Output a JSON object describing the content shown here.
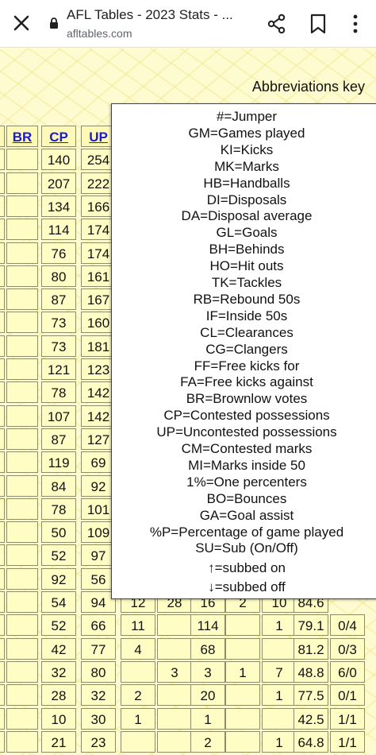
{
  "browser": {
    "title": "AFL Tables - 2023 Stats - ...",
    "url": "afltables.com"
  },
  "page": {
    "abbreviations_key": "Abbreviations key"
  },
  "table": {
    "headers": [
      "BR",
      "CP",
      "UP"
    ],
    "rows": [
      [
        "",
        "140",
        "254",
        "",
        "",
        "",
        "",
        "",
        ""
      ],
      [
        "",
        "207",
        "222",
        "",
        "",
        "",
        "",
        "",
        ""
      ],
      [
        "",
        "134",
        "166",
        "",
        "",
        "",
        "",
        "",
        ""
      ],
      [
        "",
        "114",
        "174",
        "",
        "",
        "",
        "",
        "",
        ""
      ],
      [
        "",
        "76",
        "174",
        "",
        "",
        "",
        "",
        "",
        ""
      ],
      [
        "",
        "80",
        "161",
        "",
        "",
        "",
        "",
        "",
        ""
      ],
      [
        "",
        "87",
        "167",
        "",
        "",
        "",
        "",
        "",
        ""
      ],
      [
        "",
        "73",
        "160",
        "",
        "",
        "",
        "",
        "",
        ""
      ],
      [
        "",
        "73",
        "181",
        "",
        "",
        "",
        "",
        "",
        ""
      ],
      [
        "",
        "121",
        "123",
        "",
        "",
        "",
        "",
        "",
        ""
      ],
      [
        "",
        "78",
        "142",
        "",
        "",
        "",
        "",
        "",
        ""
      ],
      [
        "",
        "107",
        "142",
        "",
        "",
        "",
        "",
        "",
        ""
      ],
      [
        "",
        "87",
        "127",
        "",
        "",
        "",
        "",
        "",
        ""
      ],
      [
        "",
        "119",
        "69",
        "",
        "",
        "",
        "",
        "",
        ""
      ],
      [
        "",
        "84",
        "92",
        "",
        "",
        "",
        "",
        "",
        ""
      ],
      [
        "",
        "78",
        "101",
        "",
        "",
        "",
        "",
        "",
        ""
      ],
      [
        "",
        "50",
        "109",
        "",
        "",
        "",
        "",
        "",
        ""
      ],
      [
        "",
        "52",
        "97",
        "",
        "",
        "",
        "",
        "",
        ""
      ],
      [
        "",
        "92",
        "56",
        "",
        "",
        "",
        "",
        "",
        ""
      ],
      [
        "",
        "54",
        "94",
        "12",
        "28",
        "16",
        "2",
        "10",
        "84.6"
      ],
      [
        "",
        "52",
        "66",
        "11",
        "",
        "114",
        "",
        "1",
        "79.1",
        "0/4"
      ],
      [
        "",
        "42",
        "77",
        "4",
        "",
        "68",
        "",
        "",
        "81.2",
        "0/3"
      ],
      [
        "",
        "32",
        "80",
        "",
        "3",
        "3",
        "1",
        "7",
        "48.8",
        "6/0"
      ],
      [
        "",
        "28",
        "32",
        "2",
        "",
        "20",
        "",
        "1",
        "77.5",
        "0/1"
      ],
      [
        "",
        "10",
        "30",
        "1",
        "",
        "1",
        "",
        "",
        "42.5",
        "1/1"
      ],
      [
        "",
        "21",
        "23",
        "",
        "",
        "2",
        "",
        "1",
        "64.8",
        "1/1"
      ]
    ]
  },
  "popup": {
    "lines": [
      "#=Jumper",
      "GM=Games played",
      "KI=Kicks",
      "MK=Marks",
      "HB=Handballs",
      "DI=Disposals",
      "DA=Disposal average",
      "GL=Goals",
      "BH=Behinds",
      "HO=Hit outs",
      "TK=Tackles",
      "RB=Rebound 50s",
      "IF=Inside 50s",
      "CL=Clearances",
      "CG=Clangers",
      "FF=Free kicks for",
      "FA=Free kicks against",
      "BR=Brownlow votes",
      "CP=Contested possessions",
      "UP=Uncontested possessions",
      "CM=Contested marks",
      "MI=Marks inside 50",
      "1%=One percenters",
      "BO=Bounces",
      "GA=Goal assist",
      "%P=Percentage of game played",
      "SU=Sub (On/Off)",
      "↑=subbed on",
      "↓=subbed off"
    ]
  }
}
